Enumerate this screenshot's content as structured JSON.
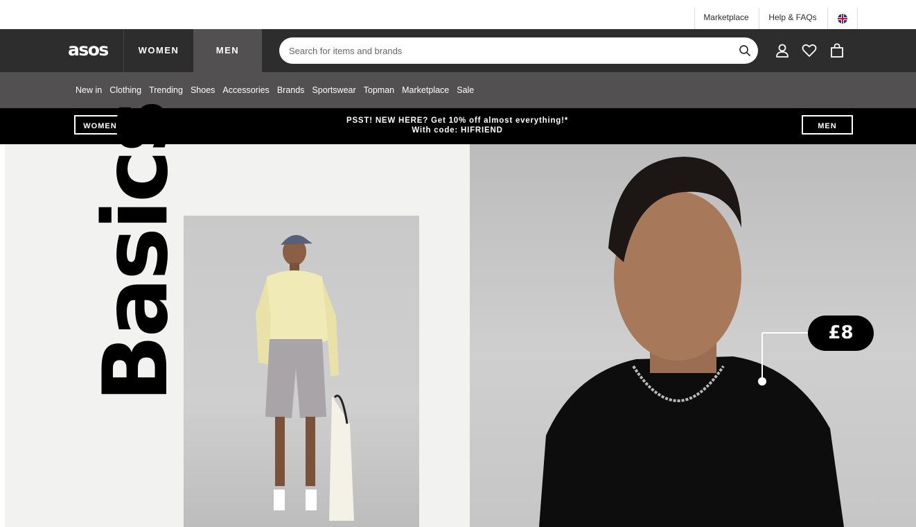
{
  "utility_bar": {
    "marketplace": "Marketplace",
    "help": "Help & FAQs",
    "flag_icon": "uk-flag-icon"
  },
  "header": {
    "logo": "asos",
    "gender_tabs": [
      {
        "label": "WOMEN",
        "active": false
      },
      {
        "label": "MEN",
        "active": true
      }
    ],
    "search": {
      "placeholder": "Search for items and brands",
      "value": ""
    },
    "icons": [
      "search-icon",
      "account-icon",
      "heart-icon",
      "bag-icon"
    ]
  },
  "nav": {
    "items": [
      "New in",
      "Clothing",
      "Trending",
      "Shoes",
      "Accessories",
      "Brands",
      "Sportswear",
      "Topman",
      "Marketplace",
      "Sale"
    ]
  },
  "promo": {
    "left_button": "WOMEN",
    "line1": "PSST! NEW HERE? Get 10% off almost everything!*",
    "line2": "With code: HIFRIEND",
    "right_button": "MEN"
  },
  "hero": {
    "headline": "Basics",
    "price_tag": "£8"
  },
  "colors": {
    "header_bg": "#2d2d2d",
    "nav_bg": "#525050",
    "promo_bg": "#000000",
    "accent": "#ffffff"
  }
}
